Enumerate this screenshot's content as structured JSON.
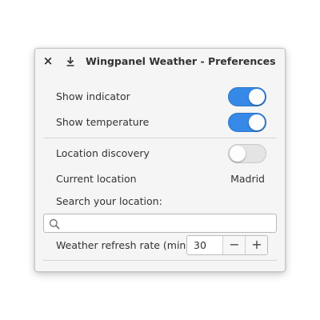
{
  "window": {
    "title": "Wingpanel Weather - Preferences",
    "close_icon": "close-icon",
    "download_icon": "download-icon"
  },
  "settings": {
    "show_indicator": {
      "label": "Show indicator",
      "enabled": true
    },
    "show_temperature": {
      "label": "Show temperature",
      "enabled": true
    },
    "location_discovery": {
      "label": "Location discovery",
      "enabled": false
    },
    "current_location": {
      "label": "Current location",
      "value": "Madrid"
    },
    "search": {
      "label": "Search your location:",
      "placeholder": "",
      "value": ""
    },
    "refresh_rate": {
      "label": "Weather refresh rate (min)",
      "value": "30",
      "minus": "−",
      "plus": "+"
    }
  },
  "colors": {
    "accent": "#3689e6",
    "switch_off": "#e4e4e4",
    "text": "#333333"
  }
}
